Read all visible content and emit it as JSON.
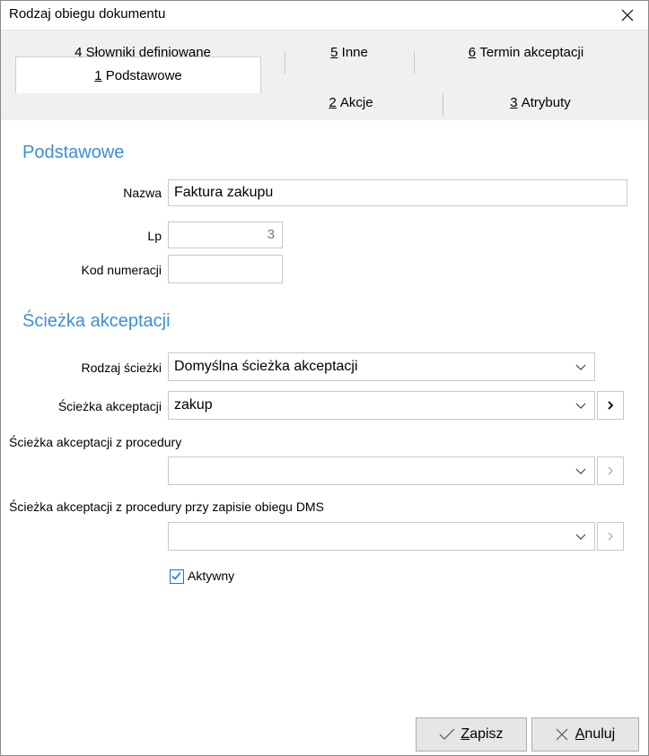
{
  "window": {
    "title": "Rodzaj obiegu dokumentu"
  },
  "tabs": {
    "row1": [
      {
        "key": "4",
        "label": "Słowniki definiowane"
      },
      {
        "key": "5",
        "label": "Inne"
      },
      {
        "key": "6",
        "label": "Termin akceptacji"
      }
    ],
    "row2": [
      {
        "key": "1",
        "label": "Podstawowe",
        "active": true
      },
      {
        "key": "2",
        "label": "Akcje"
      },
      {
        "key": "3",
        "label": "Atrybuty"
      }
    ]
  },
  "basic": {
    "heading": "Podstawowe",
    "name_label": "Nazwa",
    "name_value": "Faktura zakupu",
    "lp_label": "Lp",
    "lp_value": "3",
    "code_label": "Kod numeracji",
    "code_value": ""
  },
  "path": {
    "heading": "Ścieżka akceptacji",
    "type_label": "Rodzaj ścieżki",
    "type_value": "Domyślna ścieżka akceptacji",
    "path_label": "Ścieżka akceptacji",
    "path_value": "zakup",
    "proc_label": "Ścieżka akceptacji z procedury",
    "proc_value": "",
    "proc_dms_label": "Ścieżka akceptacji z procedury przy zapisie obiegu DMS",
    "proc_dms_value": "",
    "active_label": "Aktywny",
    "active_checked": true
  },
  "buttons": {
    "save_key": "Z",
    "save_rest": "apisz",
    "cancel_key": "A",
    "cancel_rest": "nuluj"
  },
  "colors": {
    "accent": "#3c8fd6",
    "checkbox": "#1f6fd1"
  }
}
